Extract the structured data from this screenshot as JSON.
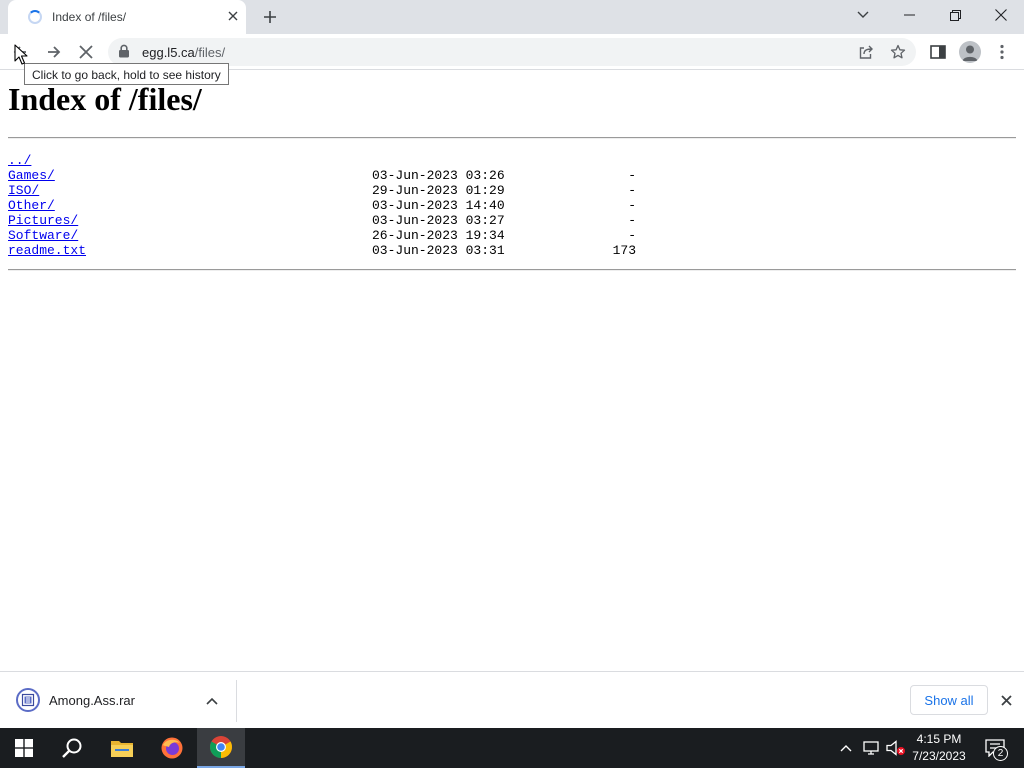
{
  "browser": {
    "tab": {
      "title": "Index of /files/",
      "loading": true
    },
    "address": {
      "host": "egg.l5.ca",
      "path": "/files/",
      "secure": true
    },
    "tooltip": "Click to go back, hold to see history",
    "icons": {
      "back": "arrow-left-icon",
      "forward": "arrow-right-icon",
      "stop": "close-icon",
      "share": "share-icon",
      "bookmark": "star-icon",
      "side_panel": "side-panel-icon",
      "profile": "avatar-icon",
      "menu": "kebab-menu-icon"
    }
  },
  "page": {
    "heading": "Index of /files/",
    "entries": [
      {
        "name": "../",
        "date": "",
        "size": ""
      },
      {
        "name": "Games/",
        "date": "03-Jun-2023 03:26",
        "size": "-"
      },
      {
        "name": "ISO/",
        "date": "29-Jun-2023 01:29",
        "size": "-"
      },
      {
        "name": "Other/",
        "date": "03-Jun-2023 14:40",
        "size": "-"
      },
      {
        "name": "Pictures/",
        "date": "03-Jun-2023 03:27",
        "size": "-"
      },
      {
        "name": "Software/",
        "date": "26-Jun-2023 19:34",
        "size": "-"
      },
      {
        "name": "readme.txt",
        "date": "03-Jun-2023 03:31",
        "size": "173"
      }
    ]
  },
  "downloads": {
    "file_name": "Among.Ass.rar",
    "show_all_label": "Show all"
  },
  "taskbar": {
    "time": "4:15 PM",
    "date": "7/23/2023",
    "notification_count": "2",
    "apps": [
      "windows-start-icon",
      "search-icon",
      "file-explorer-icon",
      "firefox-icon",
      "chrome-icon"
    ]
  },
  "colors": {
    "link": "#0000ee",
    "tab_strip": "#dee1e6",
    "omnibox": "#f1f3f4",
    "taskbar": "#1a1d20",
    "accent": "#1a73e8"
  }
}
